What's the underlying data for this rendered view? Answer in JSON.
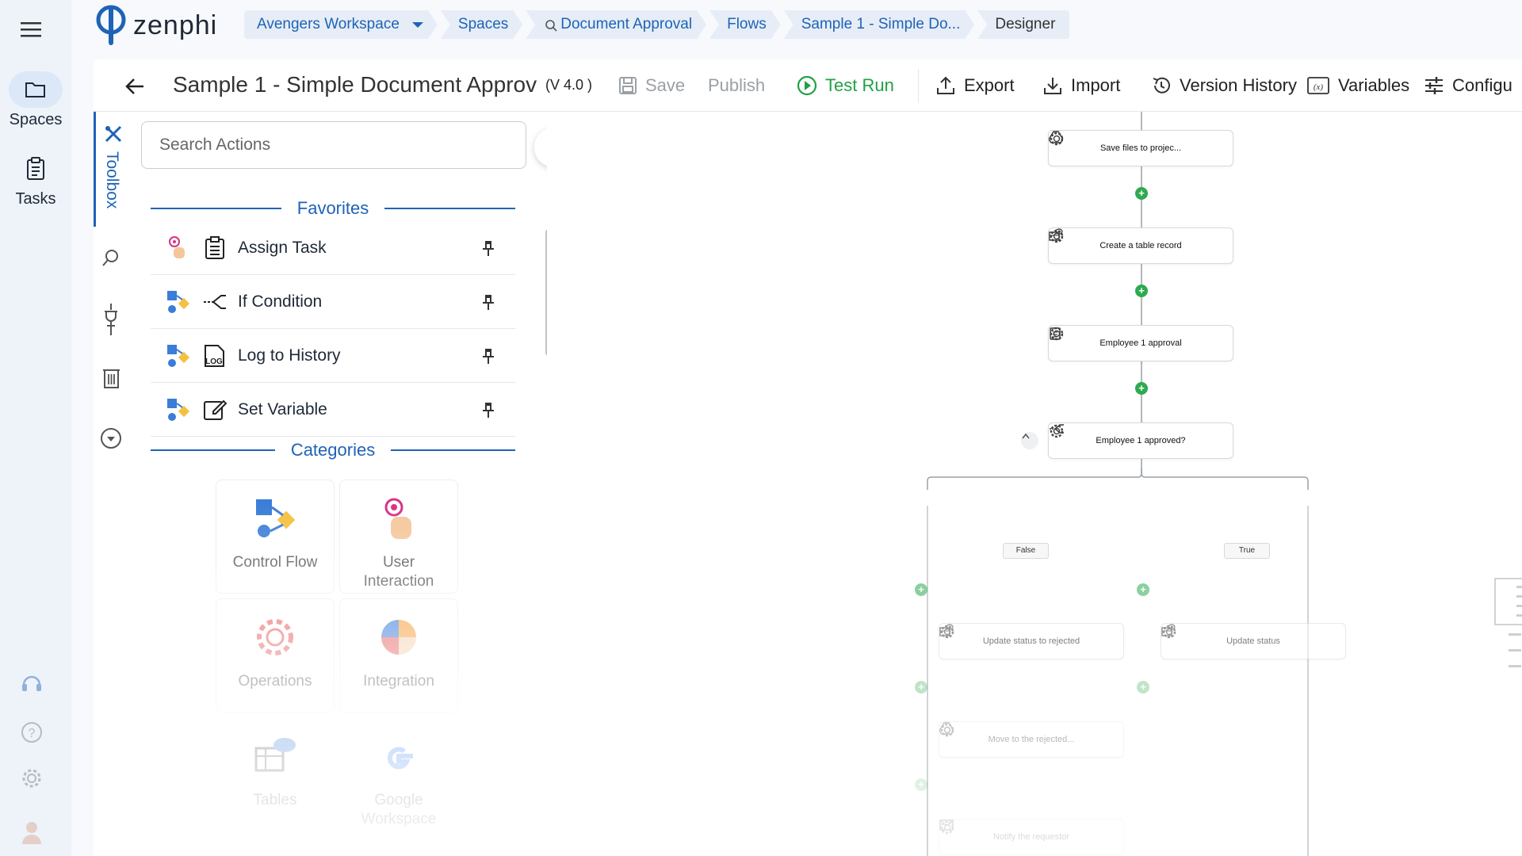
{
  "app": {
    "brand": "zenphi",
    "accent": "#1e63b6",
    "success": "#21a046"
  },
  "rail": {
    "menu_icon": "hamburger-icon",
    "items": [
      {
        "label": "Spaces",
        "icon": "folder-icon",
        "active": true
      },
      {
        "label": "Tasks",
        "icon": "clipboard-icon",
        "active": false
      }
    ],
    "bottom_icons": [
      "headset-icon",
      "help-icon",
      "gear-icon",
      "avatar"
    ]
  },
  "breadcrumbs": [
    "Avengers Workspace",
    "Spaces",
    "Document Approval",
    "Flows",
    "Sample 1 - Simple Do...",
    "Designer"
  ],
  "toolbar": {
    "title": "Sample 1 - Simple Document Approval",
    "version": "(V 4.0 )",
    "save": "Save",
    "publish": "Publish",
    "test_run": "Test Run",
    "export": "Export",
    "import": "Import",
    "version_history": "Version History",
    "variables": "Variables",
    "configure": "Configu"
  },
  "sidetabs": {
    "toolbox": "Toolbox"
  },
  "toolbox": {
    "search_placeholder": "Search Actions",
    "favorites_title": "Favorites",
    "favorites": [
      {
        "label": "Assign Task",
        "category": "user-interaction",
        "icon": "clipboard-icon"
      },
      {
        "label": "If Condition",
        "category": "control-flow",
        "icon": "branch-icon"
      },
      {
        "label": "Log to History",
        "category": "control-flow",
        "icon": "log-icon"
      },
      {
        "label": "Set Variable",
        "category": "control-flow",
        "icon": "edit-icon"
      }
    ],
    "categories_title": "Categories",
    "categories": [
      {
        "label": "Control Flow"
      },
      {
        "label": "User\nInteraction"
      },
      {
        "label": "Operations"
      },
      {
        "label": "Integration"
      },
      {
        "label": "Tables"
      },
      {
        "label": "Google\nWorkspace"
      }
    ]
  },
  "flow": {
    "nodes": [
      {
        "label": "Save files to projec...",
        "icon": "drive-icon"
      },
      {
        "label": "Create a table record",
        "icon": "table-icon"
      },
      {
        "label": "Employee 1 approval",
        "icon": "clipboard-icon"
      },
      {
        "label": "Employee 1 approved?",
        "icon": "branch-icon"
      }
    ],
    "branches": {
      "false": "False",
      "true": "True"
    },
    "false_nodes": [
      {
        "label": "Update status to rejected",
        "icon": "table-icon"
      },
      {
        "label": "Move to the rejected...",
        "icon": "drive-icon"
      },
      {
        "label": "Notify the requestor",
        "icon": "mail-icon"
      }
    ],
    "true_nodes": [
      {
        "label": "Update status",
        "icon": "table-icon"
      }
    ]
  }
}
